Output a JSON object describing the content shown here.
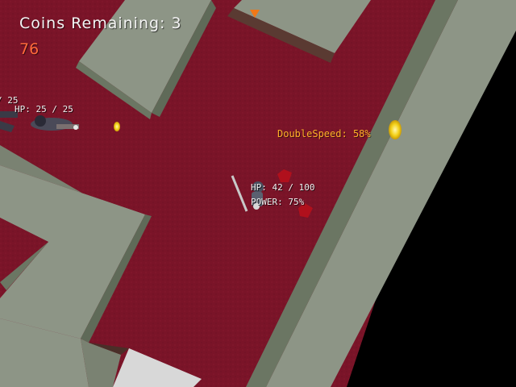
{
  "hud": {
    "coins_label": "Coins Remaining:",
    "coins_value": "3",
    "countdown": "76"
  },
  "enemy_offscreen": {
    "hp_text": "/ 25"
  },
  "enemy": {
    "hp_label": "HP:",
    "hp_current": "25",
    "hp_sep": "/",
    "hp_max": "25"
  },
  "player": {
    "hp_label": "HP:",
    "hp_current": "42",
    "hp_sep": "/",
    "hp_max": "100",
    "power_label": "POWER:",
    "power_value": "75%"
  },
  "powerup": {
    "label": "DoubleSpeed:",
    "value": "58%"
  },
  "colors": {
    "floor": "#7a1428",
    "wall_top": "#8d9586",
    "wall_side": "#5f6a58",
    "void": "#000000",
    "coin": "#f4d21a",
    "hud_white": "#f4f4f4",
    "countdown_orange": "#ff6a3a",
    "powerup_orange": "#ffb028",
    "gem_red": "#b0101c"
  }
}
